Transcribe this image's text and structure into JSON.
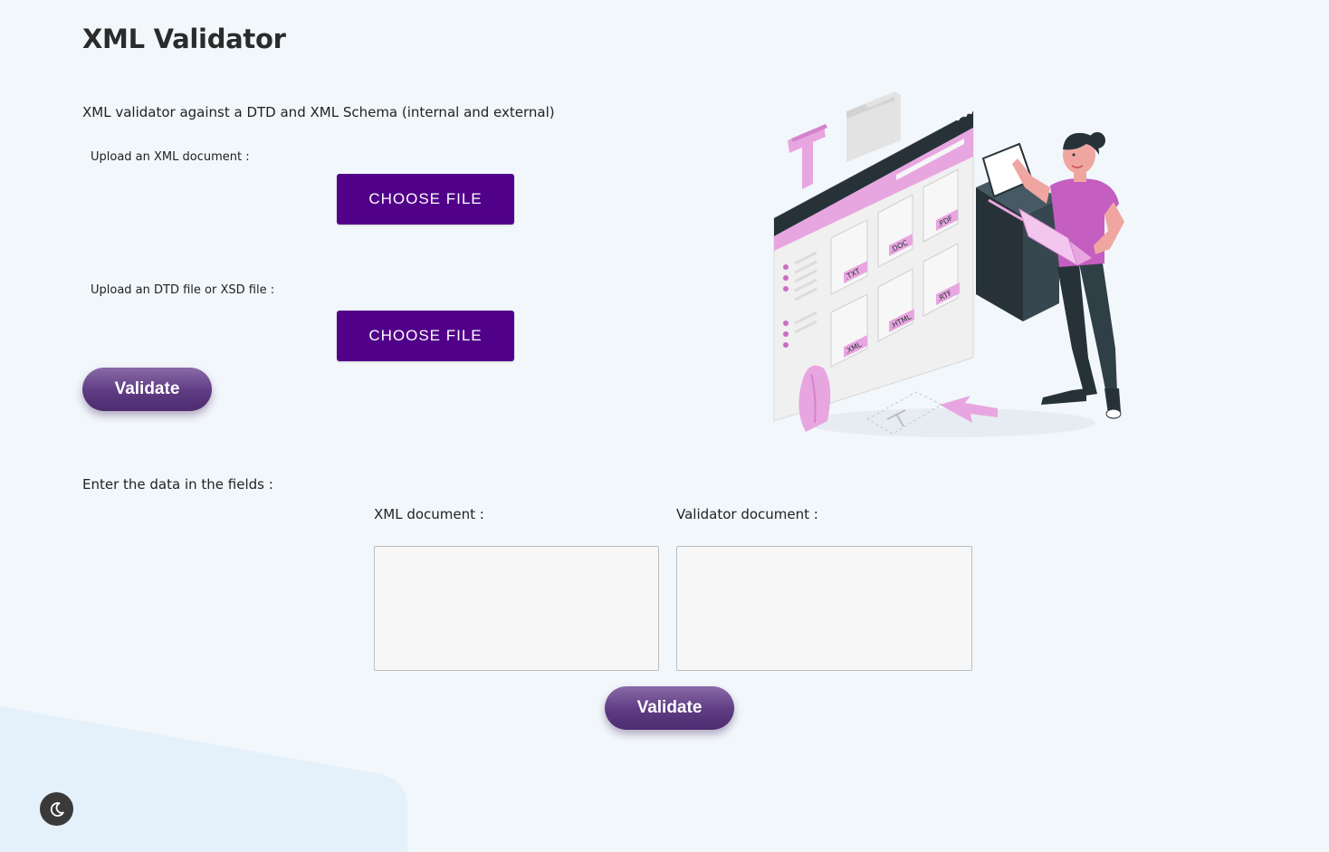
{
  "header": {
    "title": "XML Validator"
  },
  "intro": {
    "description": "XML validator against a DTD and XML Schema (internal and external)"
  },
  "upload": {
    "xml_label": "Upload an XML document :",
    "xml_button": "CHOOSE FILE",
    "schema_label": "Upload an DTD file or XSD file :",
    "schema_button": "CHOOSE FILE",
    "validate_button": "Validate"
  },
  "manual": {
    "section_label": "Enter the data in the fields :",
    "xml_label": "XML document :",
    "xml_value": "",
    "validator_label": "Validator document :",
    "validator_value": "",
    "validate_button": "Validate"
  },
  "illustration": {
    "file_types": [
      ".TXT",
      ".DOC",
      ".PDF",
      ".XML",
      ".HTML",
      ".RTF"
    ]
  },
  "theme": {
    "toggle_icon": "moon-icon"
  },
  "colors": {
    "background": "#f2f7fb",
    "choose_file": "#510089",
    "validate": "#5e3b82",
    "illustration_accent": "#e8a6e0",
    "illustration_dark": "#263238"
  }
}
